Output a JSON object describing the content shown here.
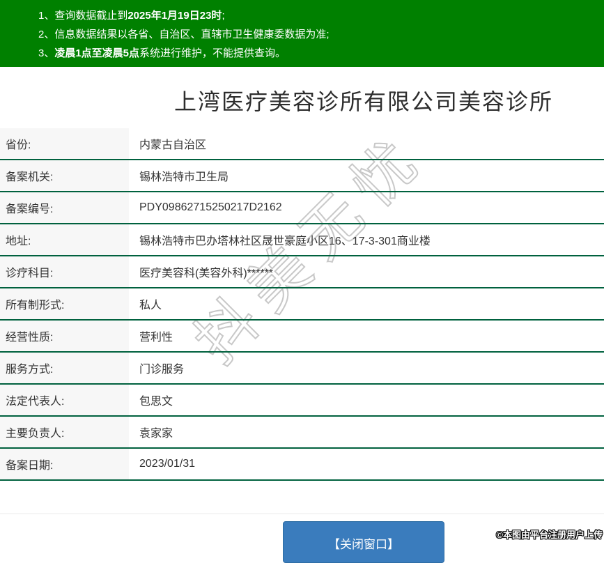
{
  "notice": {
    "lines": [
      {
        "pre": "1、查询数据截止到",
        "bold": "2025年1月19日23时",
        "post": ";"
      },
      {
        "pre": "2、信息数据结果以各省、自治区、直辖市卫生健康委数据为准;",
        "bold": "",
        "post": ""
      },
      {
        "pre": "3、",
        "bold": "凌晨1点至凌晨5点",
        "post": "系统进行维护，不能提供查询。"
      }
    ]
  },
  "page": {
    "title": "上湾医疗美容诊所有限公司美容诊所"
  },
  "record": {
    "rows": [
      {
        "label": "省份:",
        "value": "内蒙古自治区"
      },
      {
        "label": "备案机关:",
        "value": "锡林浩特市卫生局"
      },
      {
        "label": "备案编号:",
        "value": "PDY09862715250217D2162"
      },
      {
        "label": "地址:",
        "value": "锡林浩特市巴办塔林社区晟世豪庭小区16、17-3-301商业楼"
      },
      {
        "label": "诊疗科目:",
        "value": "医疗美容科(美容外科)******"
      },
      {
        "label": "所有制形式:",
        "value": "私人"
      },
      {
        "label": "经营性质:",
        "value": "营利性"
      },
      {
        "label": "服务方式:",
        "value": "门诊服务"
      },
      {
        "label": "法定代表人:",
        "value": "包思文"
      },
      {
        "label": "主要负责人:",
        "value": "袁家家"
      },
      {
        "label": "备案日期:",
        "value": "2023/01/31"
      }
    ]
  },
  "footer": {
    "close_button": "【关闭窗口】"
  },
  "watermarks": {
    "diagonal": "抖美无忧",
    "corner": "©本图由平台注册用户上传"
  },
  "colors": {
    "banner_green": "#008000",
    "divider_green": "#00613e",
    "label_bg": "#f7f7f7",
    "button_blue": "#3a7cbd",
    "button_border": "#2e6da4",
    "text": "#333333",
    "title_text": "#2d2d2d",
    "watermark_stroke": "#c8c8c8",
    "footer_line": "#e9e9e9"
  }
}
